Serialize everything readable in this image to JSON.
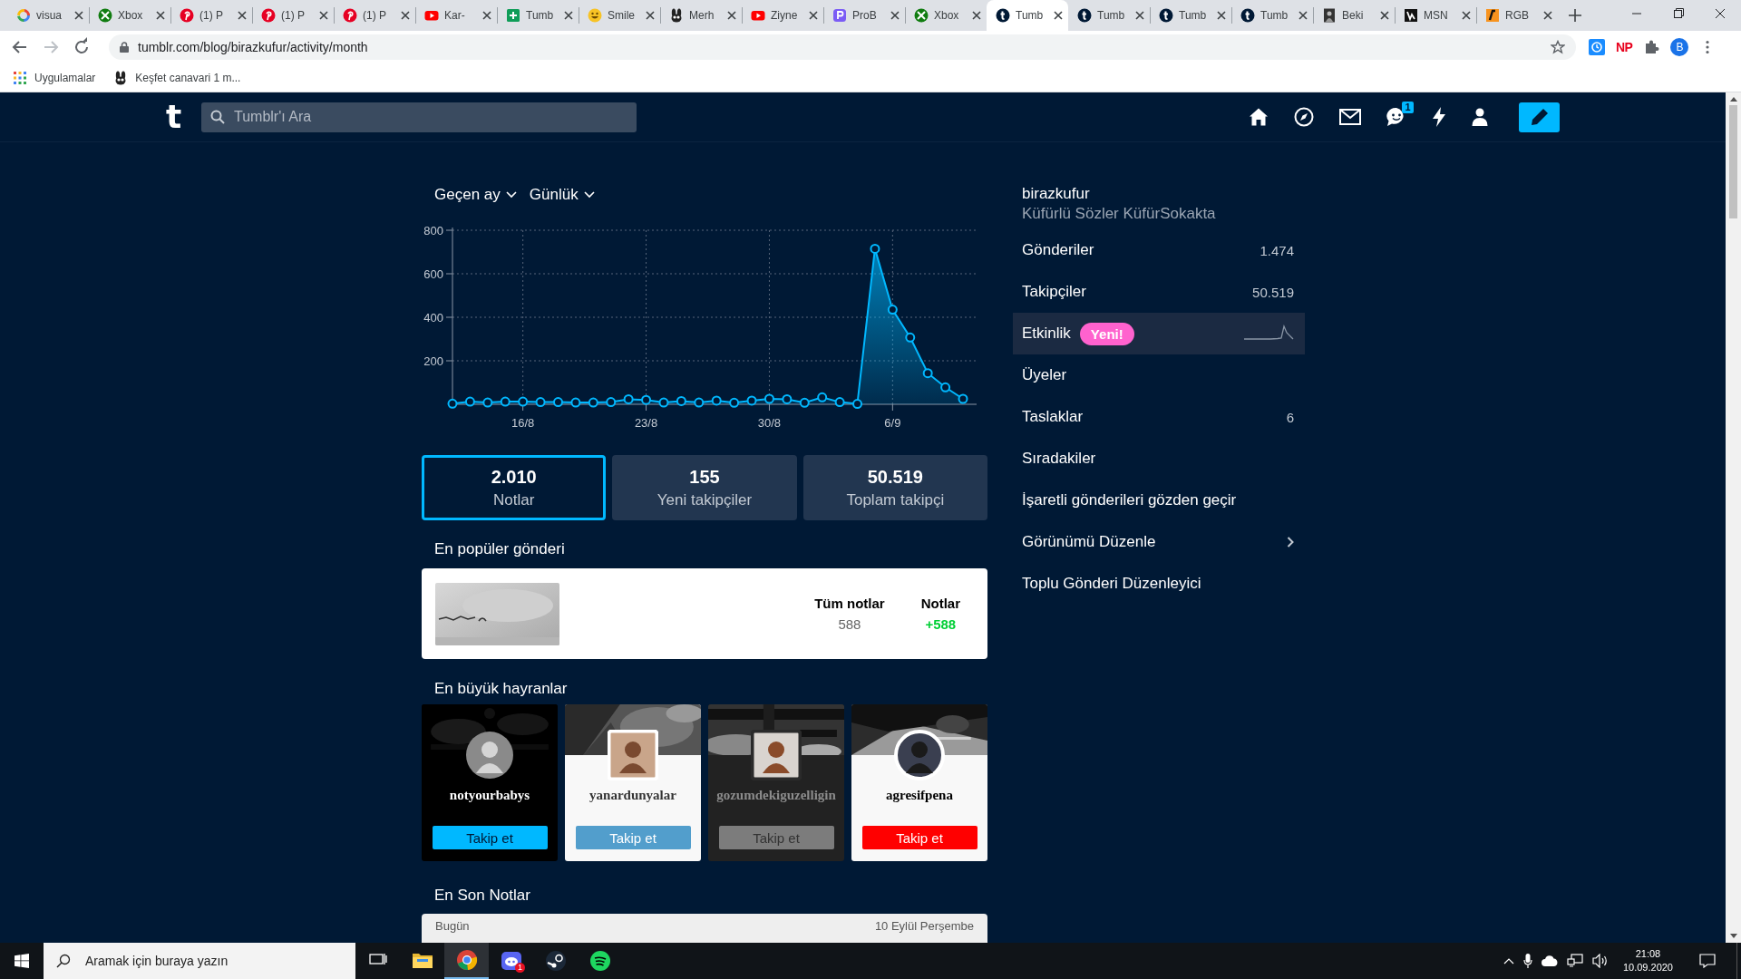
{
  "browser": {
    "tabs": [
      {
        "title": "visua",
        "kind": "google",
        "selected": false
      },
      {
        "title": "Xbox",
        "kind": "xbox",
        "selected": false
      },
      {
        "title": "(1) P",
        "kind": "pinterest",
        "selected": false
      },
      {
        "title": "(1) P",
        "kind": "pinterest",
        "selected": false
      },
      {
        "title": "(1) P",
        "kind": "pinterest",
        "selected": false
      },
      {
        "title": "Kar-",
        "kind": "youtube",
        "selected": false
      },
      {
        "title": "Tumb",
        "kind": "sheets",
        "selected": false
      },
      {
        "title": "Smile",
        "kind": "smiley",
        "selected": false
      },
      {
        "title": "Merh",
        "kind": "cartoon",
        "selected": false
      },
      {
        "title": "Ziyne",
        "kind": "youtube",
        "selected": false
      },
      {
        "title": "ProB",
        "kind": "bot",
        "selected": false
      },
      {
        "title": "Xbox",
        "kind": "xbox",
        "selected": false
      },
      {
        "title": "Tumb",
        "kind": "tumblr",
        "selected": true
      },
      {
        "title": "Tumb",
        "kind": "tumblr",
        "selected": false
      },
      {
        "title": "Tumb",
        "kind": "tumblr",
        "selected": false
      },
      {
        "title": "Tumb",
        "kind": "tumblr",
        "selected": false
      },
      {
        "title": "Beki",
        "kind": "portrait",
        "selected": false
      },
      {
        "title": "MSN",
        "kind": "msn",
        "selected": false
      },
      {
        "title": "RGB",
        "kind": "rgb",
        "selected": false
      }
    ],
    "address_bar": {
      "url": "tumblr.com/blog/birazkufur/activity/month"
    },
    "extension_label": "NP",
    "profile_initial": "B",
    "bookmarks": [
      {
        "label": "Uygulamalar",
        "kind": "apps"
      },
      {
        "label": "Keşfet canavari 1 m...",
        "kind": "cartoon"
      }
    ]
  },
  "header": {
    "logo": "t",
    "search": {
      "placeholder": "Tumblr'ı Ara"
    },
    "chat_badge": "1"
  },
  "activity": {
    "period": "Geçen ay",
    "interval": "Günlük",
    "chart_data": {
      "type": "area",
      "categories": [
        null,
        null,
        null,
        null,
        "16/8",
        null,
        null,
        null,
        null,
        null,
        null,
        "23/8",
        null,
        null,
        null,
        null,
        null,
        null,
        "30/8",
        null,
        null,
        null,
        null,
        null,
        null,
        "6/9",
        null,
        null,
        null,
        null
      ],
      "ylim": [
        0,
        800
      ],
      "yticks": [
        200,
        400,
        600,
        800
      ],
      "grid": true,
      "series": [
        {
          "color": "#00b8ff",
          "values": [
            3,
            12,
            8,
            12,
            12,
            10,
            10,
            8,
            8,
            10,
            23,
            20,
            8,
            15,
            8,
            17,
            7,
            17,
            25,
            23,
            7,
            32,
            10,
            2,
            715,
            435,
            307,
            143,
            78,
            25
          ]
        }
      ]
    },
    "stats": [
      {
        "value": "2.010",
        "label": "Notlar",
        "selected": true
      },
      {
        "value": "155",
        "label": "Yeni takipçiler",
        "selected": false
      },
      {
        "value": "50.519",
        "label": "Toplam takipçi",
        "selected": false
      }
    ],
    "popular": {
      "title": "En popüler gönderi",
      "columns": [
        {
          "label": "Tüm notlar",
          "value": "588",
          "kind": "total"
        },
        {
          "label": "Notlar",
          "value": "+588",
          "kind": "gain"
        }
      ]
    },
    "fans": {
      "title": "En büyük hayranlar",
      "items": [
        {
          "name": "notyourbabys",
          "kind": "black",
          "color": "#00b8ff",
          "button": "Takip et"
        },
        {
          "name": "yanardunyalar",
          "kind": "framed",
          "color": "#529ecc",
          "button": "Takip et"
        },
        {
          "name": "gozumdekiguzelligin",
          "kind": "dark",
          "color": "#7c7c7c",
          "button": "Takip et"
        },
        {
          "name": "agresifpena",
          "kind": "round",
          "color": "#ff0000",
          "button": "Takip et"
        }
      ]
    },
    "recent": {
      "title": "En Son Notlar",
      "day": "Bugün",
      "date": "10 Eylül Perşembe"
    }
  },
  "sidebar": {
    "blog_name": "birazkufur",
    "blog_title": "Küfürlü Sözler KüfürSokakta",
    "items": [
      {
        "label": "Gönderiler",
        "value": "1.474",
        "kind": "count",
        "selected": false
      },
      {
        "label": "Takipçiler",
        "value": "50.519",
        "kind": "count",
        "selected": false
      },
      {
        "label": "Etkinlik",
        "badge": "Yeni!",
        "kind": "activity",
        "selected": true
      },
      {
        "label": "Üyeler",
        "kind": "link",
        "selected": false
      },
      {
        "label": "Taslaklar",
        "value": "6",
        "kind": "count",
        "selected": false
      },
      {
        "label": "Sıradakiler",
        "kind": "link",
        "selected": false
      },
      {
        "label": "İşaretli gönderileri gözden geçir",
        "kind": "link",
        "selected": false
      },
      {
        "label": "Görünümü Düzenle",
        "kind": "submenu",
        "selected": false
      },
      {
        "label": "Toplu Gönderi Düzenleyici",
        "kind": "link",
        "selected": false
      }
    ]
  },
  "taskbar": {
    "search": {
      "placeholder": "Aramak için buraya yazın"
    },
    "apps": [
      {
        "kind": "taskview",
        "selected": false
      },
      {
        "kind": "folder",
        "selected": false
      },
      {
        "kind": "chrome",
        "selected": true
      },
      {
        "kind": "discord",
        "badge": "1",
        "selected": false
      },
      {
        "kind": "steam",
        "selected": false
      },
      {
        "kind": "spotify",
        "selected": false
      }
    ],
    "time": "21:08",
    "date": "10.09.2020"
  }
}
